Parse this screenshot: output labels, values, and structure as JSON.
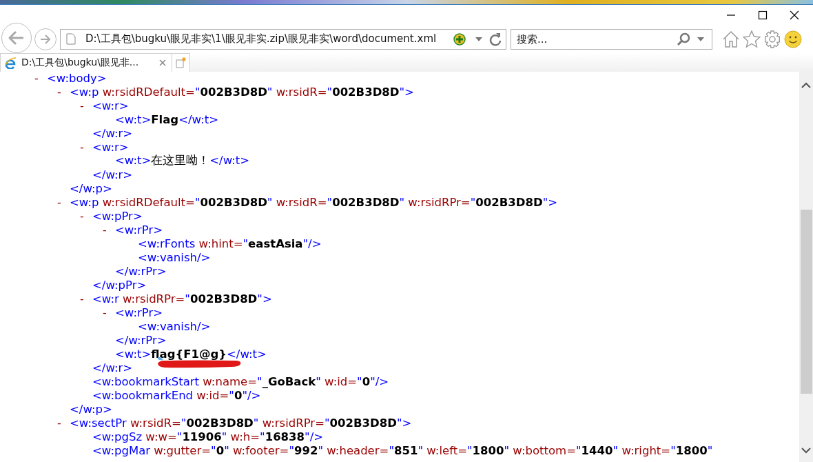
{
  "address_bar": {
    "url": "D:\\工具包\\bugku\\眼见非实\\1\\眼见非实.zip\\眼见非实\\word\\document.xml"
  },
  "search": {
    "placeholder": "搜索..."
  },
  "tabs": [
    {
      "title": "D:\\工具包\\bugku\\眼见非...",
      "selected": true
    }
  ],
  "xml": [
    {
      "toggle": "-",
      "tokens": [
        {
          "kind": "tag",
          "text": "<w:body>"
        }
      ],
      "children": [
        {
          "toggle": "-",
          "tokens": [
            {
              "kind": "tag",
              "text": "<w:p"
            },
            {
              "kind": "attr",
              "text": " w:rsidRDefault="
            },
            {
              "kind": "tag",
              "text": "\""
            },
            {
              "kind": "value",
              "text": "002B3D8D"
            },
            {
              "kind": "tag",
              "text": "\""
            },
            {
              "kind": "attr",
              "text": " w:rsidR="
            },
            {
              "kind": "tag",
              "text": "\""
            },
            {
              "kind": "value",
              "text": "002B3D8D"
            },
            {
              "kind": "tag",
              "text": "\">"
            }
          ],
          "children": [
            {
              "toggle": "-",
              "tokens": [
                {
                  "kind": "tag",
                  "text": "<w:r>"
                }
              ],
              "children": [
                {
                  "tokens": [
                    {
                      "kind": "tag",
                      "text": "<w:t>"
                    },
                    {
                      "kind": "value",
                      "text": "Flag"
                    },
                    {
                      "kind": "tag",
                      "text": "</w:t>"
                    }
                  ]
                }
              ]
            },
            {
              "tokens": [
                {
                  "kind": "tag",
                  "text": "</w:r>"
                }
              ]
            },
            {
              "toggle": "-",
              "tokens": [
                {
                  "kind": "tag",
                  "text": "<w:r>"
                }
              ],
              "children": [
                {
                  "tokens": [
                    {
                      "kind": "tag",
                      "text": "<w:t>"
                    },
                    {
                      "kind": "text",
                      "text": "在这里呦！"
                    },
                    {
                      "kind": "tag",
                      "text": "</w:t>"
                    }
                  ]
                }
              ]
            },
            {
              "tokens": [
                {
                  "kind": "tag",
                  "text": "</w:r>"
                }
              ]
            }
          ]
        },
        {
          "tokens": [
            {
              "kind": "tag",
              "text": "</w:p>"
            }
          ]
        },
        {
          "toggle": "-",
          "tokens": [
            {
              "kind": "tag",
              "text": "<w:p"
            },
            {
              "kind": "attr",
              "text": " w:rsidRDefault="
            },
            {
              "kind": "tag",
              "text": "\""
            },
            {
              "kind": "value",
              "text": "002B3D8D"
            },
            {
              "kind": "tag",
              "text": "\""
            },
            {
              "kind": "attr",
              "text": " w:rsidR="
            },
            {
              "kind": "tag",
              "text": "\""
            },
            {
              "kind": "value",
              "text": "002B3D8D"
            },
            {
              "kind": "tag",
              "text": "\""
            },
            {
              "kind": "attr",
              "text": " w:rsidRPr="
            },
            {
              "kind": "tag",
              "text": "\""
            },
            {
              "kind": "value",
              "text": "002B3D8D"
            },
            {
              "kind": "tag",
              "text": "\">"
            }
          ],
          "children": [
            {
              "toggle": "-",
              "tokens": [
                {
                  "kind": "tag",
                  "text": "<w:pPr>"
                }
              ],
              "children": [
                {
                  "toggle": "-",
                  "tokens": [
                    {
                      "kind": "tag",
                      "text": "<w:rPr>"
                    }
                  ],
                  "children": [
                    {
                      "tokens": [
                        {
                          "kind": "tag",
                          "text": "<w:rFonts"
                        },
                        {
                          "kind": "attr",
                          "text": " w:hint="
                        },
                        {
                          "kind": "tag",
                          "text": "\""
                        },
                        {
                          "kind": "value",
                          "text": "eastAsia"
                        },
                        {
                          "kind": "tag",
                          "text": "\"/>"
                        }
                      ]
                    },
                    {
                      "tokens": [
                        {
                          "kind": "tag",
                          "text": "<w:vanish/>"
                        }
                      ]
                    }
                  ]
                },
                {
                  "tokens": [
                    {
                      "kind": "tag",
                      "text": "</w:rPr>"
                    }
                  ]
                }
              ]
            },
            {
              "tokens": [
                {
                  "kind": "tag",
                  "text": "</w:pPr>"
                }
              ]
            },
            {
              "toggle": "-",
              "tokens": [
                {
                  "kind": "tag",
                  "text": "<w:r"
                },
                {
                  "kind": "attr",
                  "text": " w:rsidRPr="
                },
                {
                  "kind": "tag",
                  "text": "\""
                },
                {
                  "kind": "value",
                  "text": "002B3D8D"
                },
                {
                  "kind": "tag",
                  "text": "\">"
                }
              ],
              "children": [
                {
                  "toggle": "-",
                  "tokens": [
                    {
                      "kind": "tag",
                      "text": "<w:rPr>"
                    }
                  ],
                  "children": [
                    {
                      "tokens": [
                        {
                          "kind": "tag",
                          "text": "<w:vanish/>"
                        }
                      ]
                    }
                  ]
                },
                {
                  "tokens": [
                    {
                      "kind": "tag",
                      "text": "</w:rPr>"
                    }
                  ]
                },
                {
                  "tokens": [
                    {
                      "kind": "tag",
                      "text": "<w:t>"
                    },
                    {
                      "kind": "value",
                      "text": "flag{F1@g}"
                    },
                    {
                      "kind": "tag",
                      "text": "</w:t>"
                    }
                  ],
                  "underlined": true
                }
              ]
            },
            {
              "tokens": [
                {
                  "kind": "tag",
                  "text": "</w:r>"
                }
              ]
            },
            {
              "tokens": [
                {
                  "kind": "tag",
                  "text": "<w:bookmarkStart"
                },
                {
                  "kind": "attr",
                  "text": " w:name="
                },
                {
                  "kind": "tag",
                  "text": "\""
                },
                {
                  "kind": "value",
                  "text": "_GoBack"
                },
                {
                  "kind": "tag",
                  "text": "\""
                },
                {
                  "kind": "attr",
                  "text": " w:id="
                },
                {
                  "kind": "tag",
                  "text": "\""
                },
                {
                  "kind": "value",
                  "text": "0"
                },
                {
                  "kind": "tag",
                  "text": "\"/>"
                }
              ]
            },
            {
              "tokens": [
                {
                  "kind": "tag",
                  "text": "<w:bookmarkEnd"
                },
                {
                  "kind": "attr",
                  "text": " w:id="
                },
                {
                  "kind": "tag",
                  "text": "\""
                },
                {
                  "kind": "value",
                  "text": "0"
                },
                {
                  "kind": "tag",
                  "text": "\"/>"
                }
              ]
            }
          ]
        },
        {
          "tokens": [
            {
              "kind": "tag",
              "text": "</w:p>"
            }
          ]
        },
        {
          "toggle": "-",
          "tokens": [
            {
              "kind": "tag",
              "text": "<w:sectPr"
            },
            {
              "kind": "attr",
              "text": " w:rsidR="
            },
            {
              "kind": "tag",
              "text": "\""
            },
            {
              "kind": "value",
              "text": "002B3D8D"
            },
            {
              "kind": "tag",
              "text": "\""
            },
            {
              "kind": "attr",
              "text": " w:rsidRPr="
            },
            {
              "kind": "tag",
              "text": "\""
            },
            {
              "kind": "value",
              "text": "002B3D8D"
            },
            {
              "kind": "tag",
              "text": "\">"
            }
          ],
          "children": [
            {
              "tokens": [
                {
                  "kind": "tag",
                  "text": "<w:pgSz"
                },
                {
                  "kind": "attr",
                  "text": " w:w="
                },
                {
                  "kind": "tag",
                  "text": "\""
                },
                {
                  "kind": "value",
                  "text": "11906"
                },
                {
                  "kind": "tag",
                  "text": "\""
                },
                {
                  "kind": "attr",
                  "text": " w:h="
                },
                {
                  "kind": "tag",
                  "text": "\""
                },
                {
                  "kind": "value",
                  "text": "16838"
                },
                {
                  "kind": "tag",
                  "text": "\"/>"
                }
              ]
            },
            {
              "tokens": [
                {
                  "kind": "tag",
                  "text": "<w:pgMar"
                },
                {
                  "kind": "attr",
                  "text": " w:gutter="
                },
                {
                  "kind": "tag",
                  "text": "\""
                },
                {
                  "kind": "value",
                  "text": "0"
                },
                {
                  "kind": "tag",
                  "text": "\""
                },
                {
                  "kind": "attr",
                  "text": " w:footer="
                },
                {
                  "kind": "tag",
                  "text": "\""
                },
                {
                  "kind": "value",
                  "text": "992"
                },
                {
                  "kind": "tag",
                  "text": "\""
                },
                {
                  "kind": "attr",
                  "text": " w:header="
                },
                {
                  "kind": "tag",
                  "text": "\""
                },
                {
                  "kind": "value",
                  "text": "851"
                },
                {
                  "kind": "tag",
                  "text": "\""
                },
                {
                  "kind": "attr",
                  "text": " w:left="
                },
                {
                  "kind": "tag",
                  "text": "\""
                },
                {
                  "kind": "value",
                  "text": "1800"
                },
                {
                  "kind": "tag",
                  "text": "\""
                },
                {
                  "kind": "attr",
                  "text": " w:bottom="
                },
                {
                  "kind": "tag",
                  "text": "\""
                },
                {
                  "kind": "value",
                  "text": "1440"
                },
                {
                  "kind": "tag",
                  "text": "\""
                },
                {
                  "kind": "attr",
                  "text": " w:right="
                },
                {
                  "kind": "tag",
                  "text": "\""
                },
                {
                  "kind": "value",
                  "text": "1800"
                },
                {
                  "kind": "tag",
                  "text": "\""
                }
              ]
            }
          ]
        }
      ]
    }
  ]
}
